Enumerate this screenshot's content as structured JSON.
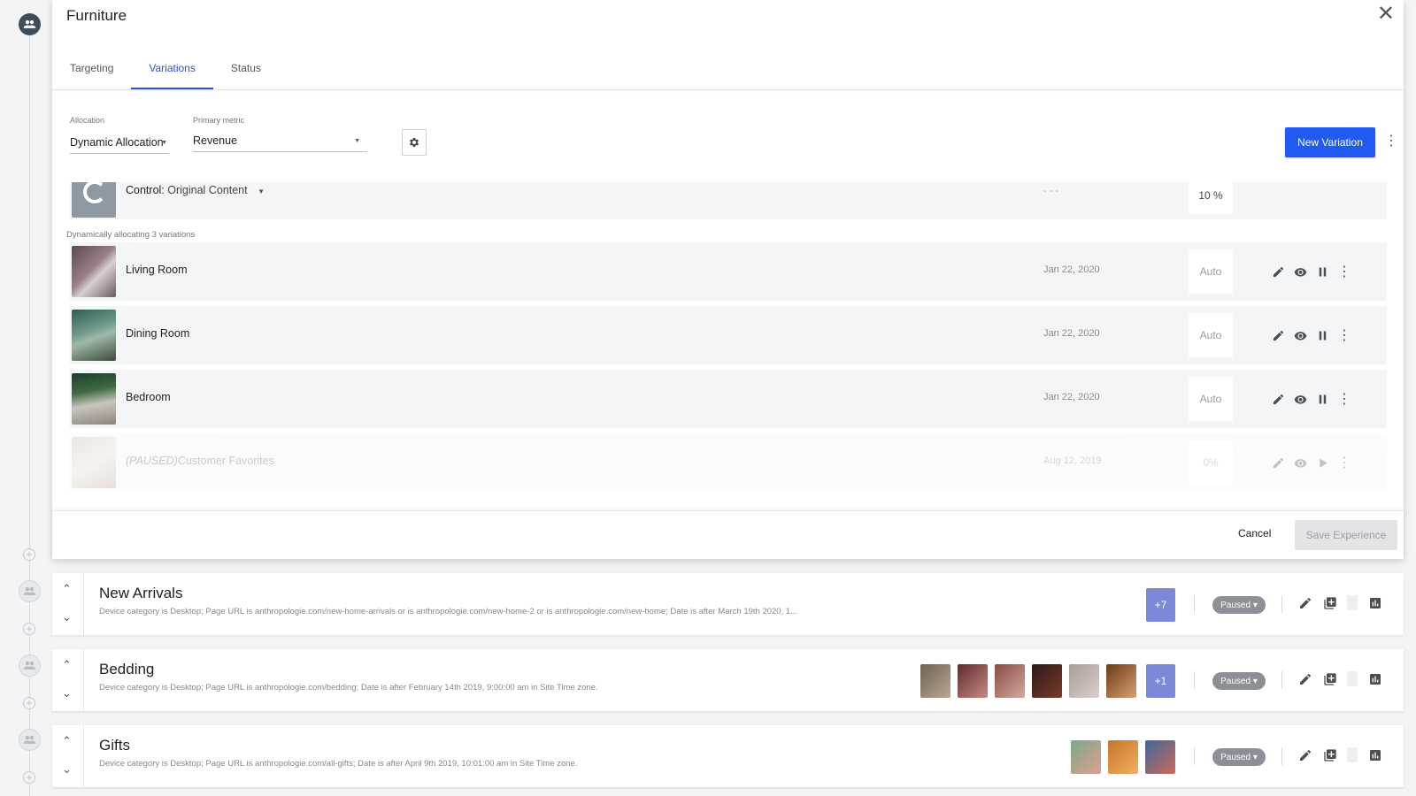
{
  "modal": {
    "title": "Furniture",
    "tabs": [
      {
        "label": "Targeting"
      },
      {
        "label": "Variations"
      },
      {
        "label": "Status"
      }
    ],
    "allocation": {
      "label": "Allocation",
      "value": "Dynamic Allocation"
    },
    "primary_metric": {
      "label": "Primary metric",
      "value": "Revenue"
    },
    "new_variation_label": "New Variation",
    "control": {
      "prefix": "Control:",
      "name": "Original Content",
      "date": "- - -",
      "alloc": "10 %"
    },
    "dynamic_note": "Dynamically allocating 3 variations",
    "variations": [
      {
        "name": "Living Room",
        "date": "Jan 22, 2020",
        "alloc": "Auto"
      },
      {
        "name": "Dining Room",
        "date": "Jan 22, 2020",
        "alloc": "Auto"
      },
      {
        "name": "Bedroom",
        "date": "Jan 22, 2020",
        "alloc": "Auto"
      }
    ],
    "paused_variation": {
      "tag": "(PAUSED)",
      "name": "Customer Favorites",
      "date": "Aug 12, 2019",
      "alloc": "0%"
    },
    "cancel_label": "Cancel",
    "save_label": "Save Experience"
  },
  "experiences": [
    {
      "title": "New Arrivals",
      "desc": "Device category is Desktop; Page URL is anthropologie.com/new-home-arrivals or is anthropologie.com/new-home-2 or is anthropologie.com/new-home; Date is after March 19th 2020, 1...",
      "more": "+7",
      "status": "Paused"
    },
    {
      "title": "Bedding",
      "desc": "Device category is Desktop; Page URL is anthropologie.com/bedding; Date is after February 14th 2019, 9:00:00 am in Site Time zone.",
      "more": "+1",
      "status": "Paused"
    },
    {
      "title": "Gifts",
      "desc": "Device category is Desktop; Page URL is anthropologie.com/all-gifts; Date is after April 9th 2019, 10:01:00 am in Site Time zone.",
      "status": "Paused"
    }
  ],
  "colors": {
    "accent": "#1f5bf0",
    "badge": "#7b89d8",
    "status_pill": "#8c9096"
  },
  "icons": [
    "audience-icon",
    "close-icon",
    "gear-icon",
    "pencil-icon",
    "eye-icon",
    "pause-icon",
    "play-icon",
    "kebab-icon",
    "add-box-icon",
    "bar-chart-icon",
    "chevron-up-icon",
    "chevron-down-icon"
  ]
}
